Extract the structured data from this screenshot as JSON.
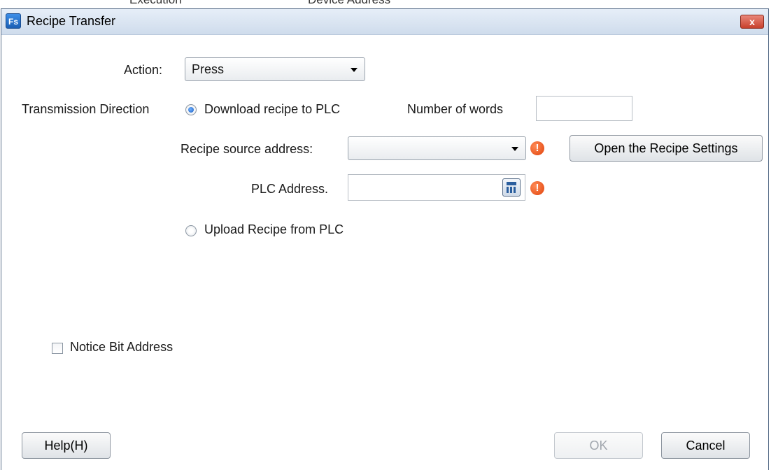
{
  "background": {
    "left_text": "Execution",
    "right_text": "Device Address"
  },
  "window": {
    "title": "Recipe Transfer",
    "app_icon": "Fs",
    "close_label": "x"
  },
  "action": {
    "label": "Action:",
    "value": "Press"
  },
  "transmission": {
    "label": "Transmission Direction",
    "download_label": "Download recipe to PLC",
    "download_selected": true,
    "upload_label": "Upload Recipe from PLC",
    "upload_selected": false
  },
  "number_of_words": {
    "label": "Number of words",
    "value": ""
  },
  "recipe_source": {
    "label": "Recipe source address:",
    "value": "",
    "open_button": "Open the Recipe Settings"
  },
  "plc_address": {
    "label": "PLC Address.",
    "value": ""
  },
  "notice_bit": {
    "label": "Notice Bit Address",
    "checked": false
  },
  "footer": {
    "help": "Help(H)",
    "ok": "OK",
    "cancel": "Cancel"
  },
  "colors": {
    "title_bar": "#cfdcec",
    "close": "#c8402c",
    "warning": "#e0420b",
    "radio_selected": "#1d5fbf"
  }
}
